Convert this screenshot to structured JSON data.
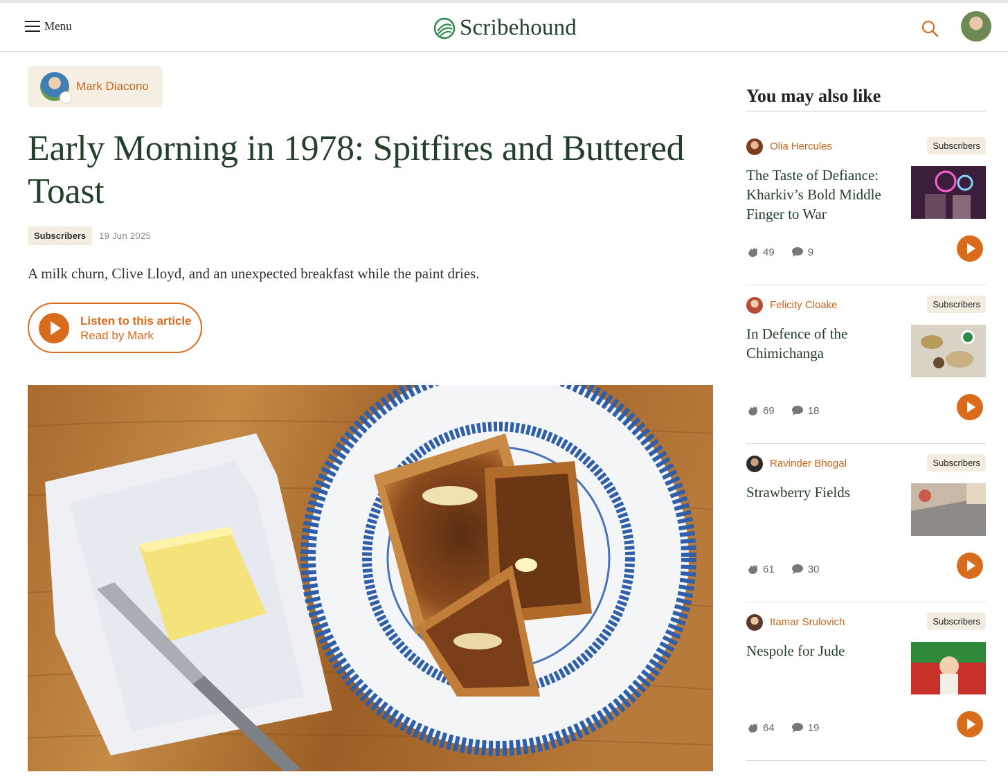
{
  "header": {
    "menu_label": "Menu",
    "brand": "Scribehound",
    "icons": [
      "hamburger-icon",
      "logo-icon",
      "search-icon",
      "avatar"
    ]
  },
  "colors": {
    "accent": "#d96b1d",
    "headline": "#24402b",
    "chip_bg": "#f5efe3"
  },
  "article": {
    "author": "Mark Diacono",
    "title": "Early Morning in 1978: Spitfires and Buttered Toast",
    "badge": "Subscribers",
    "date": "19 Jun 2025",
    "standfirst": "A milk churn, Clive Lloyd, and an unexpected breakfast while the paint dries.",
    "listen_label": "Listen to this article",
    "listen_sub": "Read by Mark"
  },
  "sidebar": {
    "title": "You may also like",
    "cards": [
      {
        "author": "Olia Hercules",
        "badge": "Subscribers",
        "title": "The Taste of Defiance: Kharkiv’s Bold Middle Finger to War",
        "claps": "49",
        "comments": "9"
      },
      {
        "author": "Felicity Cloake",
        "badge": "Subscribers",
        "title": "In Defence of the Chimichanga",
        "claps": "69",
        "comments": "18"
      },
      {
        "author": "Ravinder Bhogal",
        "badge": "Subscribers",
        "title": "Strawberry Fields",
        "claps": "61",
        "comments": "30"
      },
      {
        "author": "Itamar Srulovich",
        "badge": "Subscribers",
        "title": "Nespole for Jude",
        "claps": "64",
        "comments": "19"
      }
    ]
  }
}
